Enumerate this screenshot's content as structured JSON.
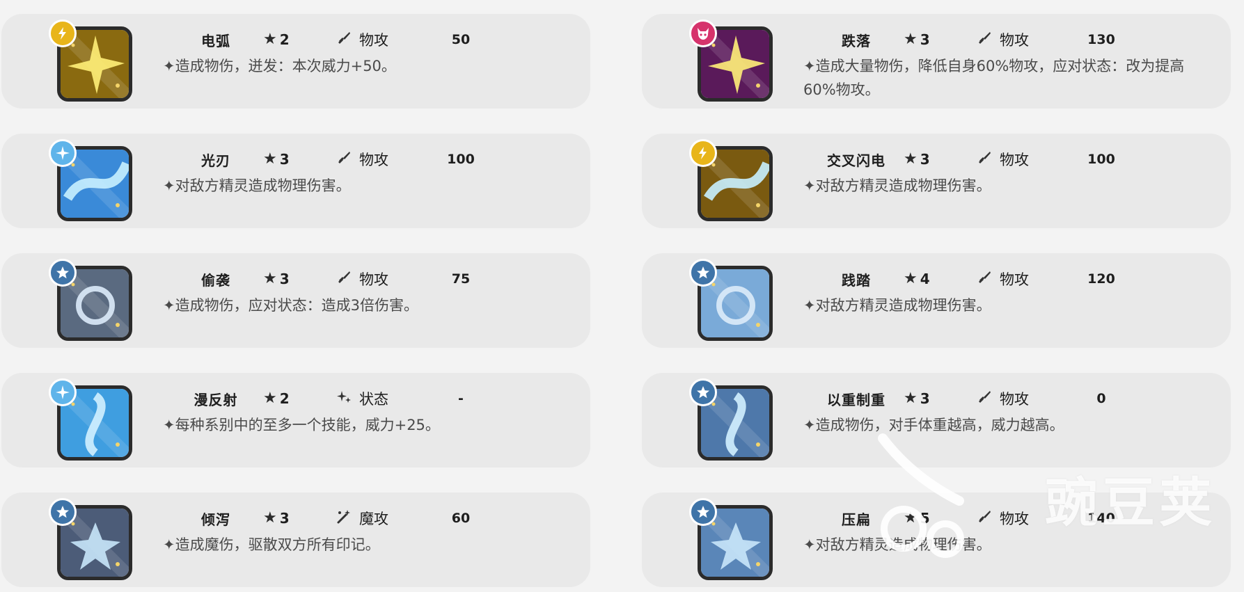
{
  "skills": [
    {
      "name": "电弧",
      "cost": "2",
      "category": "物攻",
      "power": "50",
      "desc": "✦造成物伤，迸发：本次威力+50。",
      "type_icon": "lightning-icon",
      "type_color": "#e8b51a",
      "tile_color": "#8a6a10",
      "cat_icon": "sword-icon"
    },
    {
      "name": "光刃",
      "cost": "3",
      "category": "物攻",
      "power": "100",
      "desc": "✦对敌方精灵造成物理伤害。",
      "type_icon": "light-star-icon",
      "type_color": "#5fb4ea",
      "tile_color": "#3a8ad8",
      "cat_icon": "sword-icon"
    },
    {
      "name": "偷袭",
      "cost": "3",
      "category": "物攻",
      "power": "75",
      "desc": "✦造成物伤，应对状态：造成3倍伤害。",
      "type_icon": "normal-star-icon",
      "type_color": "#3f74a8",
      "tile_color": "#5a6a80",
      "cat_icon": "sword-icon"
    },
    {
      "name": "漫反射",
      "cost": "2",
      "category": "状态",
      "power": "-",
      "desc": "✦每种系别中的至多一个技能，威力+25。",
      "type_icon": "light-star-icon",
      "type_color": "#5fb4ea",
      "tile_color": "#3f9ee0",
      "cat_icon": "sparkle-icon"
    },
    {
      "name": "倾泻",
      "cost": "3",
      "category": "魔攻",
      "power": "60",
      "desc": "✦造成魔伤，驱散双方所有印记。",
      "type_icon": "normal-star-icon",
      "type_color": "#3f74a8",
      "tile_color": "#4c5c78",
      "cat_icon": "magic-wand-icon"
    },
    {
      "name": "跌落",
      "cost": "3",
      "category": "物攻",
      "power": "130",
      "desc": "✦造成大量物伤，降低自身60%物攻，应对状态：改为提高60%物攻。",
      "type_icon": "demon-icon",
      "type_color": "#d6336c",
      "tile_color": "#5a1a5a",
      "cat_icon": "sword-icon"
    },
    {
      "name": "交叉闪电",
      "cost": "3",
      "category": "物攻",
      "power": "100",
      "desc": "✦对敌方精灵造成物理伤害。",
      "type_icon": "lightning-icon",
      "type_color": "#e8b51a",
      "tile_color": "#7a5a10",
      "cat_icon": "sword-icon"
    },
    {
      "name": "践踏",
      "cost": "4",
      "category": "物攻",
      "power": "120",
      "desc": "✦对敌方精灵造成物理伤害。",
      "type_icon": "normal-star-icon",
      "type_color": "#3f74a8",
      "tile_color": "#7aaad8",
      "cat_icon": "sword-icon"
    },
    {
      "name": "以重制重",
      "cost": "3",
      "category": "物攻",
      "power": "0",
      "desc": "✦造成物伤，对手体重越高，威力越高。",
      "type_icon": "normal-star-icon",
      "type_color": "#3f74a8",
      "tile_color": "#4e78aa",
      "cat_icon": "sword-icon"
    },
    {
      "name": "压扁",
      "cost": "5",
      "category": "物攻",
      "power": "140",
      "desc": "✦对敌方精灵造成物理伤害。",
      "type_icon": "normal-star-icon",
      "type_color": "#3f74a8",
      "tile_color": "#5a86b8",
      "cat_icon": "sword-icon"
    }
  ],
  "watermark": "豌豆荚"
}
